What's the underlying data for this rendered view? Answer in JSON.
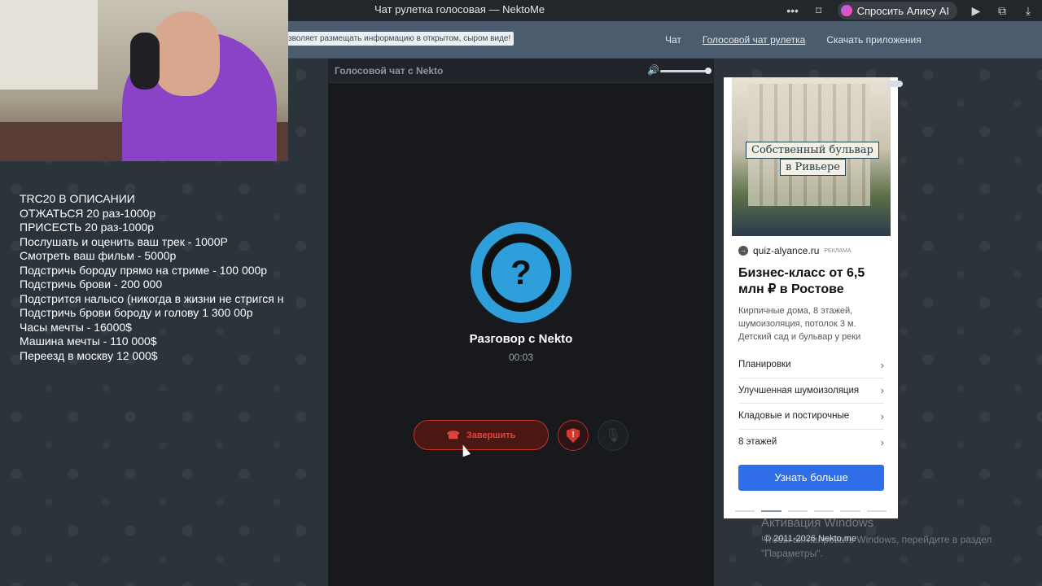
{
  "browser": {
    "tab_title": "Чат рулетка голосовая — NektoMe",
    "alice_label": "Спросить Алису AI",
    "icons": [
      "more-icon",
      "bookmark-icon",
      "alice-icon",
      "play-icon",
      "translate-icon",
      "download-icon"
    ]
  },
  "header": {
    "notice": "зволяет размещать информацию в открытом, сыром виде!",
    "nav": [
      "Чат",
      "Голосовой чат рулетка",
      "Скачать приложения"
    ],
    "active_nav": "Голосовой чат рулетка"
  },
  "overlay": {
    "lines": [
      "TRC20 В ОПИСАНИИ",
      "ОТЖАТЬСЯ 20 раз-1000р",
      "ПРИСЕСТЬ 20 раз-1000р",
      "Послушать и оценить ваш трек - 1000Р",
      "Смотреть ваш фильм - 5000р",
      "Подстричь бороду прямо на стриме - 100 000р",
      "Подстричь брови - 200 000",
      "Подстрится налысо (никогда в жизни не стригся н",
      "Подстричь брови бороду и голову 1 300 00р",
      "Часы мечты - 16000$",
      "Машина мечты - 110 000$",
      "Переезд в москву 12 000$"
    ]
  },
  "call": {
    "header_title": "Голосовой чат с Nekto",
    "volume_level": 1.0,
    "avatar_glyph": "?",
    "partner_name": "Разговор с Nekto",
    "timer": "00:03",
    "end_label": "Завершить"
  },
  "ad": {
    "image_caption_1": "Собственный бульвар",
    "image_caption_2": "в Ривьере",
    "domain": "quiz-alyance.ru",
    "tag": "РЕКЛАМА",
    "title": "Бизнес-класс от 6,5 млн ₽ в Ростове",
    "description": "Кирпичные дома, 8 этажей, шумоизоляция, потолок 3 м. Детский сад и бульвар у реки",
    "items": [
      "Планировки",
      "Улучшенная шумоизоляция",
      "Кладовые и постирочные",
      "8 этажей"
    ],
    "cta": "Узнать больше"
  },
  "footer": {
    "copyright": "© 2011-2026 Nekto.me"
  },
  "watermark": {
    "title": "Активация Windows",
    "text": "Чтобы активировать Windows, перейдите в раздел \"Параметры\"."
  },
  "colors": {
    "accent_blue": "#2f9fdc",
    "end_red": "#e0473a",
    "cta_blue": "#2f6ee8"
  }
}
